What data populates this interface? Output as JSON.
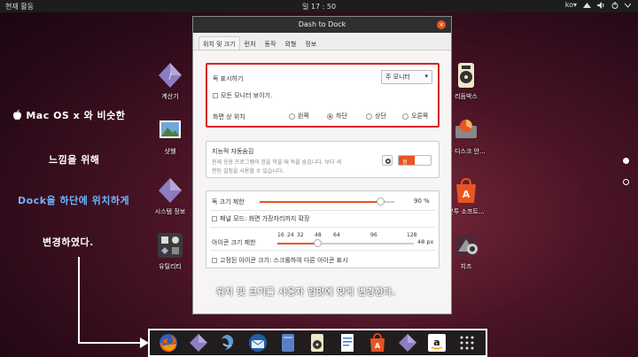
{
  "topbar": {
    "activities": "현재 활동",
    "clock": "일 17 : 50",
    "lang": "ko",
    "lang_arrow": "▾"
  },
  "desktop_left": [
    {
      "label": "계산기",
      "icon": "calculator-icon"
    },
    {
      "label": "샷웰",
      "icon": "shotwell-icon"
    },
    {
      "label": "시스템 정보",
      "icon": "system-info-icon"
    },
    {
      "label": "유틸리티",
      "icon": "utilities-folder-icon"
    }
  ],
  "desktop_right": [
    {
      "label": "리듬박스",
      "icon": "rhythmbox-icon"
    },
    {
      "label": "동 디스크 안...",
      "icon": "disk-usage-icon"
    },
    {
      "label": "분투 소프트...",
      "icon": "ubuntu-software-icon"
    },
    {
      "label": "치즈",
      "icon": "cheese-icon"
    }
  ],
  "annotations": {
    "line1": "Mac OS x 와 비슷한",
    "line2": "느낌을 위해",
    "line3": "Dock을 하단에 위치하게",
    "line4": "변경하였다.",
    "bottom": "위치 및 크기를 사용자 입맛에 맞게 변경한다."
  },
  "dialog": {
    "title": "Dash to Dock",
    "close": "×",
    "tabs": [
      "위치 및 크기",
      "런처",
      "동작",
      "외형",
      "정보"
    ],
    "position": {
      "show_on": "독 표시하기",
      "monitor": "주 모니터",
      "monitor_arrow": "▾",
      "all_monitors": "모든 모니터 보이기.",
      "screen_pos": "화면 상 위치",
      "options": [
        "왼쪽",
        "하단",
        "상단",
        "오른쪽"
      ]
    },
    "autohide": {
      "title": "지능적 자동숨김",
      "desc1": "현재 응용 프로그램의 창을 막을 때 독을 숨깁니다. 보다 세",
      "desc2": "련된 설정을 사용할 수 있습니다.",
      "toggle": "켬"
    },
    "size": {
      "dock_size": "독 크기 제한",
      "dock_size_value": "90 %",
      "dock_size_fraction": 0.9,
      "panel_mode": "패널 모드: 화면 가장자리까지 확장",
      "icon_size": "아이콘 크기 제한",
      "icon_ticks": [
        "16",
        "24",
        "32",
        "48",
        "64",
        "96",
        "128"
      ],
      "icon_value": "48 px",
      "fixed_icon": "고정된 아이콘 크기: 스크롤하여 다른 아이콘 표시"
    }
  },
  "dock": [
    "firefox-icon",
    "diamond-app-icon",
    "steam-like-icon",
    "thunderbird-icon",
    "files-icon",
    "rhythmbox-icon",
    "writer-icon",
    "software-icon",
    "diamond-app2-icon",
    "amazon-icon",
    "app-grid-icon"
  ],
  "colors": {
    "accent": "#e95420",
    "highlight_red": "#d8232a",
    "annotation_blue": "#6fb6ff"
  }
}
